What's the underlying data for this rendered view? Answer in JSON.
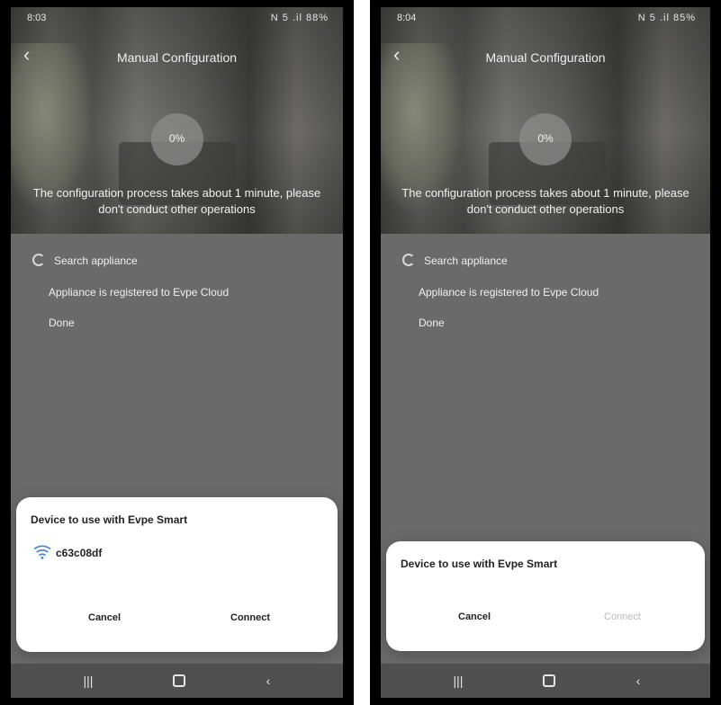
{
  "screens": [
    {
      "status_time": "8:03",
      "status_icons": "N 5 .il 88%",
      "title": "Manual Configuration",
      "progress": "0%",
      "notice": "The configuration process takes about 1 minute, please don't conduct other operations",
      "steps": [
        {
          "label": "Search appliance",
          "icon": "spinner-icon"
        },
        {
          "label": "Appliance is registered to Evpe Cloud"
        },
        {
          "label": "Done"
        }
      ],
      "dialog": {
        "heading": "Device to use with Evpe Smart",
        "device_name": "c63c08df",
        "cancel_label": "Cancel",
        "connect_label": "Connect",
        "connect_enabled": true
      },
      "nav_icons": [
        "recent-apps-icon",
        "home-icon",
        "back-icon"
      ]
    },
    {
      "status_time": "8:04",
      "status_icons": "N 5 .il 85%",
      "title": "Manual Configuration",
      "progress": "0%",
      "notice": "The configuration process takes about 1 minute, please don't conduct other operations",
      "steps": [
        {
          "label": "Search appliance",
          "icon": "spinner-icon"
        },
        {
          "label": "Appliance is registered to Evpe Cloud"
        },
        {
          "label": "Done"
        }
      ],
      "dialog": {
        "heading": "Device to use with Evpe Smart",
        "cancel_label": "Cancel",
        "connect_label": "Connect",
        "connect_enabled": false
      },
      "nav_icons": [
        "recent-apps-icon",
        "home-icon",
        "back-icon"
      ]
    }
  ]
}
